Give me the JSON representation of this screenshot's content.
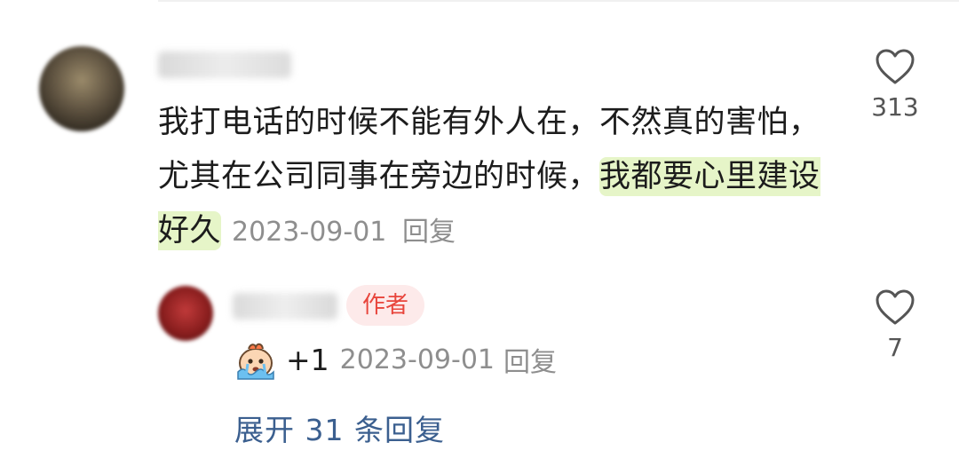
{
  "comment": {
    "text_plain": "我打电话的时候不能有外人在，不然真的害怕，尤其在公司同事在旁边的时候，",
    "text_highlight": "我都要心里建设好久",
    "date": "2023-09-01",
    "reply_label": "回复",
    "like_icon": "heart-outline-icon",
    "like_count": "313"
  },
  "reply": {
    "author_badge": "作者",
    "emoji_icon": "crying-face-emoji",
    "text": "+1",
    "date": "2023-09-01",
    "reply_label": "回复",
    "like_icon": "heart-outline-icon",
    "like_count": "7"
  },
  "expand_replies": "展开 31 条回复",
  "colors": {
    "highlight": "#e6f5c8",
    "badge_bg": "#fdeaea",
    "badge_text": "#e8453c",
    "link": "#3b5f8f",
    "meta": "#8e8e8e"
  }
}
